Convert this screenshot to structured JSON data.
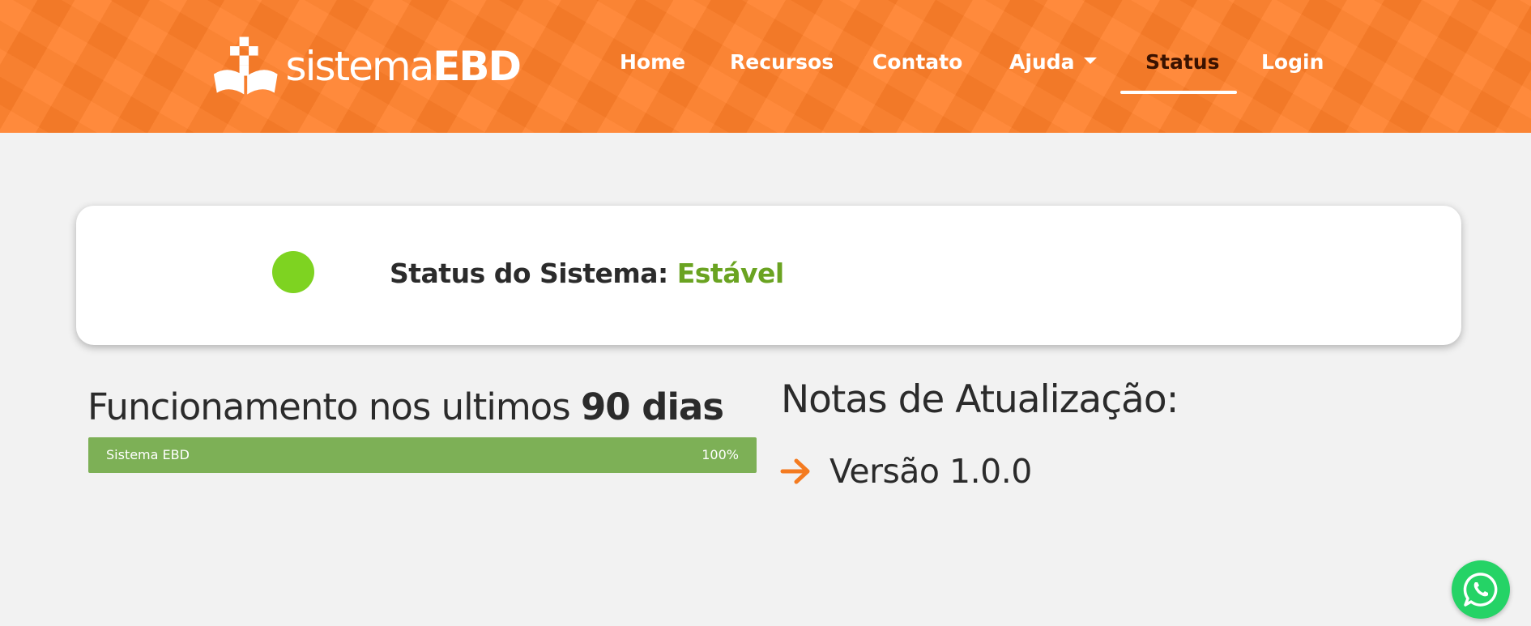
{
  "header": {
    "logo": {
      "text_light": "sistema",
      "text_bold": "EBD"
    },
    "nav": [
      {
        "label": "Home",
        "active": false
      },
      {
        "label": "Recursos",
        "active": false
      },
      {
        "label": "Contato",
        "active": false
      },
      {
        "label": "Ajuda",
        "active": false,
        "has_dropdown": true
      },
      {
        "label": "Status",
        "active": true
      },
      {
        "label": "Login",
        "active": false
      }
    ],
    "colors": {
      "background": "#ff7f2a",
      "active_text": "#3a1200"
    }
  },
  "status": {
    "label": "Status do Sistema:",
    "value": "Estável",
    "indicator_color": "#7ed321",
    "value_color": "#6aa321"
  },
  "uptime": {
    "title_prefix": "Funcionamento nos ultimos",
    "title_days": "90 dias",
    "bars": [
      {
        "name": "Sistema EBD",
        "percent": "100%",
        "color": "#7db056"
      }
    ]
  },
  "notes": {
    "title": "Notas de Atualização:",
    "items": [
      {
        "icon": "arrow-right-icon",
        "label": "Versão 1.0.0",
        "icon_color": "#f47b20"
      }
    ]
  },
  "floating": {
    "whatsapp": {
      "icon": "whatsapp-icon",
      "color": "#25d366"
    }
  }
}
